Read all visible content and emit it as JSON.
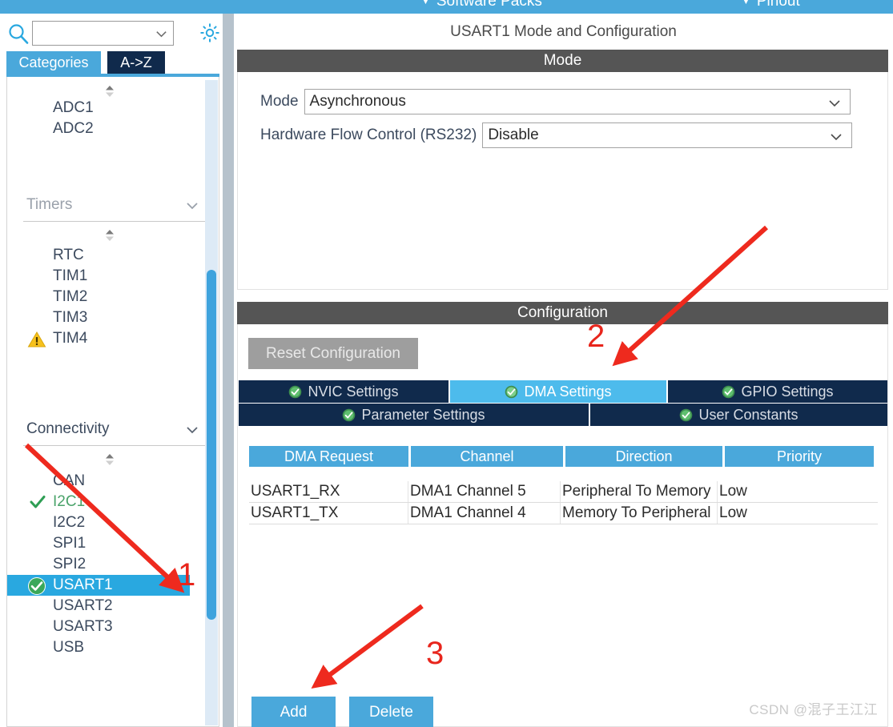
{
  "topbar": {
    "software_packs": "Software Packs",
    "pinout": "Pinout",
    "caret": "▼"
  },
  "left_panel": {
    "search": {
      "value": "",
      "placeholder": "",
      "icon": "search-icon"
    },
    "gear_icon": "gear-icon",
    "tabs": [
      {
        "label": "Categories",
        "active": true
      },
      {
        "label": "A->Z",
        "active": false
      }
    ],
    "groups": [
      {
        "name": "",
        "header": "",
        "items": [
          {
            "label": "ADC1",
            "status": "none"
          },
          {
            "label": "ADC2",
            "status": "none"
          }
        ]
      },
      {
        "name": "timers",
        "header": "Timers",
        "items": [
          {
            "label": "RTC",
            "status": "none"
          },
          {
            "label": "TIM1",
            "status": "none"
          },
          {
            "label": "TIM2",
            "status": "none"
          },
          {
            "label": "TIM3",
            "status": "none"
          },
          {
            "label": "TIM4",
            "status": "warning"
          }
        ]
      },
      {
        "name": "connectivity",
        "header": "Connectivity",
        "items": [
          {
            "label": "CAN",
            "status": "none"
          },
          {
            "label": "I2C1",
            "status": "check"
          },
          {
            "label": "I2C2",
            "status": "none"
          },
          {
            "label": "SPI1",
            "status": "none"
          },
          {
            "label": "SPI2",
            "status": "none"
          },
          {
            "label": "USART1",
            "status": "enabled",
            "selected": true
          },
          {
            "label": "USART2",
            "status": "none"
          },
          {
            "label": "USART3",
            "status": "none"
          },
          {
            "label": "USB",
            "status": "none"
          }
        ]
      }
    ]
  },
  "right_panel": {
    "title": "USART1 Mode and Configuration",
    "mode_section": {
      "header": "Mode",
      "fields": [
        {
          "label": "Mode",
          "value": "Asynchronous"
        },
        {
          "label": "Hardware Flow Control (RS232)",
          "value": "Disable"
        }
      ]
    },
    "configuration_section": {
      "header": "Configuration",
      "reset_button": "Reset Configuration",
      "tabs_row1": [
        {
          "label": "NVIC Settings",
          "active": false
        },
        {
          "label": "DMA Settings",
          "active": true
        },
        {
          "label": "GPIO Settings",
          "active": false
        }
      ],
      "tabs_row2": [
        {
          "label": "Parameter Settings",
          "active": false
        },
        {
          "label": "User Constants",
          "active": false
        }
      ],
      "dma_table": {
        "columns": [
          "DMA Request",
          "Channel",
          "Direction",
          "Priority"
        ],
        "rows": [
          [
            "USART1_RX",
            "DMA1 Channel 5",
            "Peripheral To Memory",
            "Low"
          ],
          [
            "USART1_TX",
            "DMA1 Channel 4",
            "Memory To Peripheral",
            "Low"
          ]
        ]
      },
      "add_button": "Add",
      "delete_button": "Delete"
    }
  },
  "watermark": "CSDN @混子王江江",
  "annotations": {
    "step1": "1",
    "step2": "2",
    "step3": "3",
    "color": "#e8251c"
  }
}
